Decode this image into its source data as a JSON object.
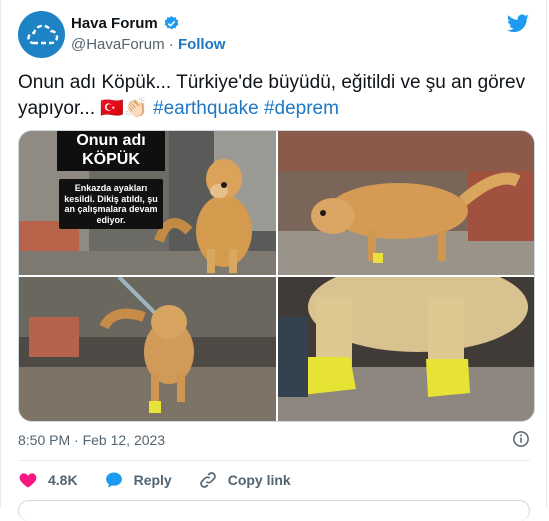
{
  "author": {
    "name": "Hava Forum",
    "handle": "@HavaForum",
    "separator": "·",
    "follow_label": "Follow"
  },
  "tweet": {
    "text_main": "Onun adı Köpük... Türkiye'de büyüdü, eğitildi ve şu an görev yapıyor...",
    "emoji": "🇹🇷👏🏻",
    "hashtag_1": "#earthquake",
    "hashtag_2": "#deprem"
  },
  "media": {
    "image_1_title": "Onun adı KÖPÜK",
    "image_1_caption": "Enkazda ayakları kesildi. Dikiş atıldı, şu an çalışmalara devam ediyor.",
    "count": 4
  },
  "meta": {
    "time": "8:50 PM · Feb 12, 2023"
  },
  "actions": {
    "likes": "4.8K",
    "reply_label": "Reply",
    "copy_link_label": "Copy link"
  },
  "colors": {
    "accent": "#1d77c2",
    "like": "#f91880",
    "avatar": "#1e83c4",
    "bird": "#1d9bf0"
  },
  "icons": [
    "hava-forum-logo",
    "verified-badge-icon",
    "twitter-bird-icon",
    "info-icon",
    "heart-icon",
    "reply-icon",
    "link-icon"
  ]
}
